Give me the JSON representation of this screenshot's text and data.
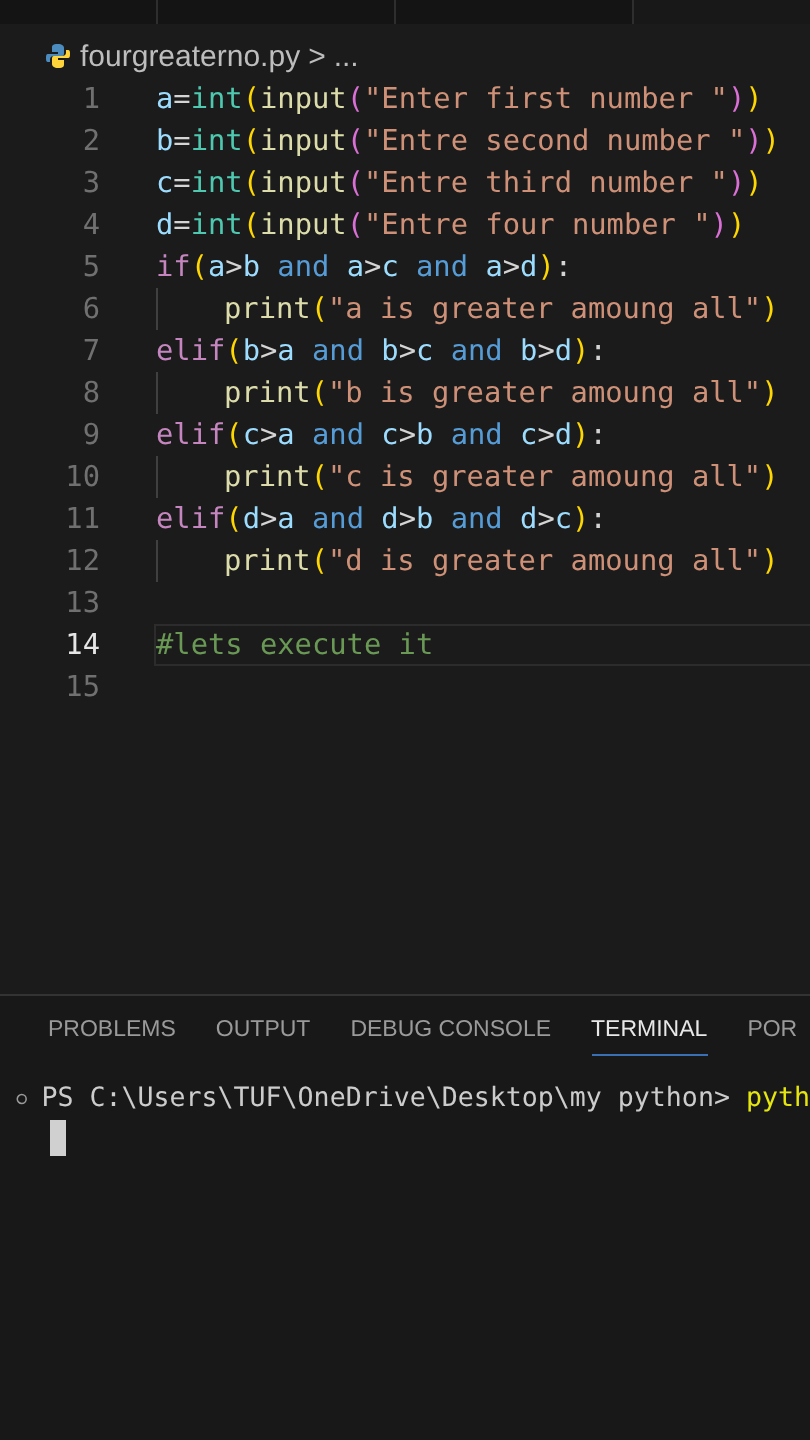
{
  "breadcrumb": {
    "file": "fourgreaterno.py",
    "separator": ">",
    "more": "..."
  },
  "lines": [
    {
      "number": "1",
      "indented": false,
      "current": false,
      "tokens": [
        {
          "t": "a",
          "color": "#9cdcfe"
        },
        {
          "t": "=",
          "color": "#d4d4d4"
        },
        {
          "t": "int",
          "color": "#4ec9b0"
        },
        {
          "t": "(",
          "color": "#ffd700"
        },
        {
          "t": "input",
          "color": "#dcdcaa"
        },
        {
          "t": "(",
          "color": "#da70d6"
        },
        {
          "t": "\"Enter first number \"",
          "color": "#ce9178"
        },
        {
          "t": ")",
          "color": "#da70d6"
        },
        {
          "t": ")",
          "color": "#ffd700"
        }
      ]
    },
    {
      "number": "2",
      "indented": false,
      "current": false,
      "tokens": [
        {
          "t": "b",
          "color": "#9cdcfe"
        },
        {
          "t": "=",
          "color": "#d4d4d4"
        },
        {
          "t": "int",
          "color": "#4ec9b0"
        },
        {
          "t": "(",
          "color": "#ffd700"
        },
        {
          "t": "input",
          "color": "#dcdcaa"
        },
        {
          "t": "(",
          "color": "#da70d6"
        },
        {
          "t": "\"Entre second number \"",
          "color": "#ce9178"
        },
        {
          "t": ")",
          "color": "#da70d6"
        },
        {
          "t": ")",
          "color": "#ffd700"
        }
      ]
    },
    {
      "number": "3",
      "indented": false,
      "current": false,
      "tokens": [
        {
          "t": "c",
          "color": "#9cdcfe"
        },
        {
          "t": "=",
          "color": "#d4d4d4"
        },
        {
          "t": "int",
          "color": "#4ec9b0"
        },
        {
          "t": "(",
          "color": "#ffd700"
        },
        {
          "t": "input",
          "color": "#dcdcaa"
        },
        {
          "t": "(",
          "color": "#da70d6"
        },
        {
          "t": "\"Entre third number \"",
          "color": "#ce9178"
        },
        {
          "t": ")",
          "color": "#da70d6"
        },
        {
          "t": ")",
          "color": "#ffd700"
        }
      ]
    },
    {
      "number": "4",
      "indented": false,
      "current": false,
      "tokens": [
        {
          "t": "d",
          "color": "#9cdcfe"
        },
        {
          "t": "=",
          "color": "#d4d4d4"
        },
        {
          "t": "int",
          "color": "#4ec9b0"
        },
        {
          "t": "(",
          "color": "#ffd700"
        },
        {
          "t": "input",
          "color": "#dcdcaa"
        },
        {
          "t": "(",
          "color": "#da70d6"
        },
        {
          "t": "\"Entre four number \"",
          "color": "#ce9178"
        },
        {
          "t": ")",
          "color": "#da70d6"
        },
        {
          "t": ")",
          "color": "#ffd700"
        }
      ]
    },
    {
      "number": "5",
      "indented": false,
      "current": false,
      "tokens": [
        {
          "t": "if",
          "color": "#c586c0"
        },
        {
          "t": "(",
          "color": "#ffd700"
        },
        {
          "t": "a",
          "color": "#9cdcfe"
        },
        {
          "t": ">",
          "color": "#d4d4d4"
        },
        {
          "t": "b",
          "color": "#9cdcfe"
        },
        {
          "t": " and ",
          "color": "#569cd6"
        },
        {
          "t": "a",
          "color": "#9cdcfe"
        },
        {
          "t": ">",
          "color": "#d4d4d4"
        },
        {
          "t": "c",
          "color": "#9cdcfe"
        },
        {
          "t": " and ",
          "color": "#569cd6"
        },
        {
          "t": "a",
          "color": "#9cdcfe"
        },
        {
          "t": ">",
          "color": "#d4d4d4"
        },
        {
          "t": "d",
          "color": "#9cdcfe"
        },
        {
          "t": ")",
          "color": "#ffd700"
        },
        {
          "t": ":",
          "color": "#d4d4d4"
        }
      ]
    },
    {
      "number": "6",
      "indented": true,
      "current": false,
      "tokens": [
        {
          "t": "print",
          "color": "#dcdcaa"
        },
        {
          "t": "(",
          "color": "#ffd700"
        },
        {
          "t": "\"a is greater amoung all\"",
          "color": "#ce9178"
        },
        {
          "t": ")",
          "color": "#ffd700"
        }
      ]
    },
    {
      "number": "7",
      "indented": false,
      "current": false,
      "tokens": [
        {
          "t": "elif",
          "color": "#c586c0"
        },
        {
          "t": "(",
          "color": "#ffd700"
        },
        {
          "t": "b",
          "color": "#9cdcfe"
        },
        {
          "t": ">",
          "color": "#d4d4d4"
        },
        {
          "t": "a",
          "color": "#9cdcfe"
        },
        {
          "t": " and ",
          "color": "#569cd6"
        },
        {
          "t": "b",
          "color": "#9cdcfe"
        },
        {
          "t": ">",
          "color": "#d4d4d4"
        },
        {
          "t": "c",
          "color": "#9cdcfe"
        },
        {
          "t": " and ",
          "color": "#569cd6"
        },
        {
          "t": "b",
          "color": "#9cdcfe"
        },
        {
          "t": ">",
          "color": "#d4d4d4"
        },
        {
          "t": "d",
          "color": "#9cdcfe"
        },
        {
          "t": ")",
          "color": "#ffd700"
        },
        {
          "t": ":",
          "color": "#d4d4d4"
        }
      ]
    },
    {
      "number": "8",
      "indented": true,
      "current": false,
      "tokens": [
        {
          "t": "print",
          "color": "#dcdcaa"
        },
        {
          "t": "(",
          "color": "#ffd700"
        },
        {
          "t": "\"b is greater amoung all\"",
          "color": "#ce9178"
        },
        {
          "t": ")",
          "color": "#ffd700"
        }
      ]
    },
    {
      "number": "9",
      "indented": false,
      "current": false,
      "tokens": [
        {
          "t": "elif",
          "color": "#c586c0"
        },
        {
          "t": "(",
          "color": "#ffd700"
        },
        {
          "t": "c",
          "color": "#9cdcfe"
        },
        {
          "t": ">",
          "color": "#d4d4d4"
        },
        {
          "t": "a",
          "color": "#9cdcfe"
        },
        {
          "t": " and ",
          "color": "#569cd6"
        },
        {
          "t": "c",
          "color": "#9cdcfe"
        },
        {
          "t": ">",
          "color": "#d4d4d4"
        },
        {
          "t": "b",
          "color": "#9cdcfe"
        },
        {
          "t": " and ",
          "color": "#569cd6"
        },
        {
          "t": "c",
          "color": "#9cdcfe"
        },
        {
          "t": ">",
          "color": "#d4d4d4"
        },
        {
          "t": "d",
          "color": "#9cdcfe"
        },
        {
          "t": ")",
          "color": "#ffd700"
        },
        {
          "t": ":",
          "color": "#d4d4d4"
        }
      ]
    },
    {
      "number": "10",
      "indented": true,
      "current": false,
      "tokens": [
        {
          "t": "print",
          "color": "#dcdcaa"
        },
        {
          "t": "(",
          "color": "#ffd700"
        },
        {
          "t": "\"c is greater amoung all\"",
          "color": "#ce9178"
        },
        {
          "t": ")",
          "color": "#ffd700"
        }
      ]
    },
    {
      "number": "11",
      "indented": false,
      "current": false,
      "tokens": [
        {
          "t": "elif",
          "color": "#c586c0"
        },
        {
          "t": "(",
          "color": "#ffd700"
        },
        {
          "t": "d",
          "color": "#9cdcfe"
        },
        {
          "t": ">",
          "color": "#d4d4d4"
        },
        {
          "t": "a",
          "color": "#9cdcfe"
        },
        {
          "t": " and ",
          "color": "#569cd6"
        },
        {
          "t": "d",
          "color": "#9cdcfe"
        },
        {
          "t": ">",
          "color": "#d4d4d4"
        },
        {
          "t": "b",
          "color": "#9cdcfe"
        },
        {
          "t": " and ",
          "color": "#569cd6"
        },
        {
          "t": "d",
          "color": "#9cdcfe"
        },
        {
          "t": ">",
          "color": "#d4d4d4"
        },
        {
          "t": "c",
          "color": "#9cdcfe"
        },
        {
          "t": ")",
          "color": "#ffd700"
        },
        {
          "t": ":",
          "color": "#d4d4d4"
        }
      ]
    },
    {
      "number": "12",
      "indented": true,
      "current": false,
      "tokens": [
        {
          "t": "print",
          "color": "#dcdcaa"
        },
        {
          "t": "(",
          "color": "#ffd700"
        },
        {
          "t": "\"d is greater amoung all\"",
          "color": "#ce9178"
        },
        {
          "t": ")",
          "color": "#ffd700"
        }
      ]
    },
    {
      "number": "13",
      "indented": false,
      "current": false
    },
    {
      "number": "14",
      "indented": false,
      "current": true,
      "tokens": [
        {
          "t": "#lets execute it",
          "color": "#6a9955"
        }
      ]
    },
    {
      "number": "15",
      "indented": false,
      "current": false
    }
  ],
  "panel_tabs": [
    {
      "label": "PROBLEMS",
      "selected": false
    },
    {
      "label": "OUTPUT",
      "selected": false
    },
    {
      "label": "DEBUG CONSOLE",
      "selected": false
    },
    {
      "label": "TERMINAL",
      "selected": true
    },
    {
      "label": "POR",
      "selected": false
    }
  ],
  "terminal": {
    "prompt": "PS C:\\Users\\TUF\\OneDrive\\Desktop\\my python> ",
    "command": "pyth"
  }
}
